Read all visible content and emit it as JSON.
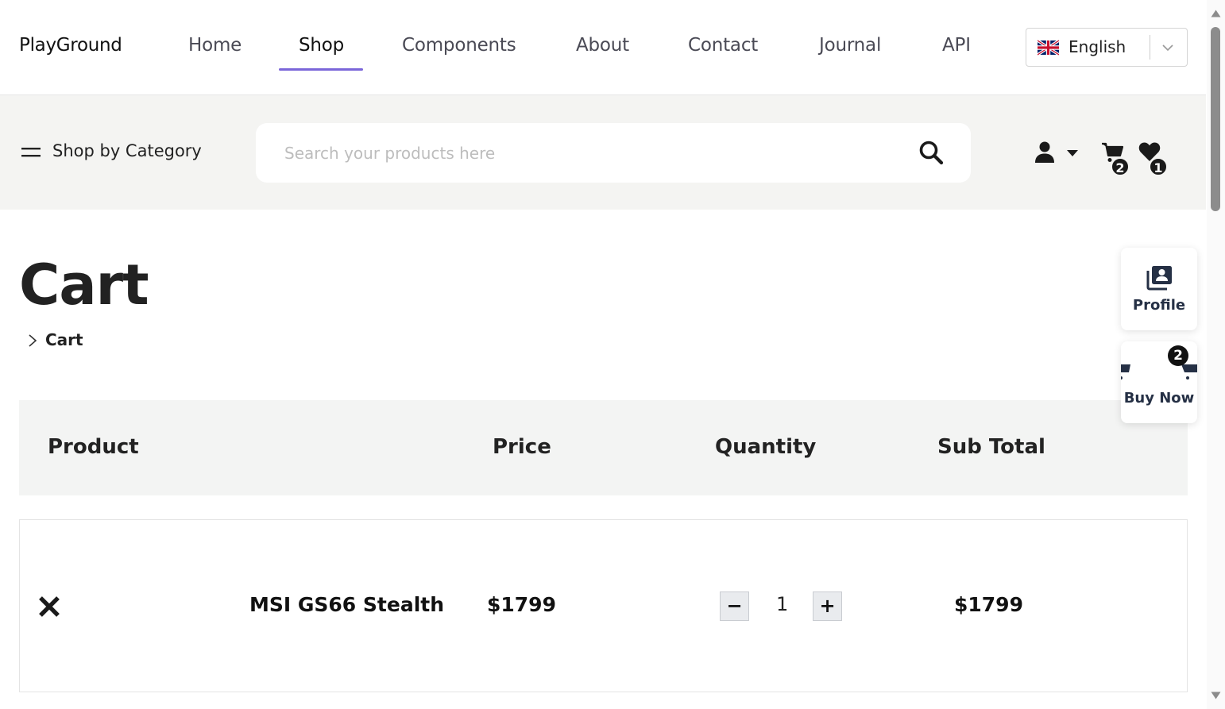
{
  "brand": "PlayGround",
  "nav": {
    "items": [
      {
        "label": "Home"
      },
      {
        "label": "Shop"
      },
      {
        "label": "Components"
      },
      {
        "label": "About"
      },
      {
        "label": "Contact"
      },
      {
        "label": "Journal"
      },
      {
        "label": "API"
      }
    ],
    "active": "Shop"
  },
  "language": {
    "selected": "English",
    "flag": "uk-flag-icon"
  },
  "category_menu": {
    "label": "Shop by Category",
    "icon": "hamburger-icon"
  },
  "search": {
    "placeholder": "Search your products here",
    "value": ""
  },
  "header_actions": {
    "cart_count": "2",
    "wishlist_count": "1"
  },
  "page": {
    "title": "Cart",
    "breadcrumb": "Cart"
  },
  "table": {
    "headers": {
      "product": "Product",
      "price": "Price",
      "quantity": "Quantity",
      "subtotal": "Sub Total"
    },
    "rows": [
      {
        "name": "MSI GS66 Stealth",
        "price": "$1799",
        "quantity": "1",
        "subtotal": "$1799",
        "decrement": "−",
        "increment": "+"
      }
    ]
  },
  "floating": {
    "profile_label": "Profile",
    "buy_label": "Buy Now",
    "buy_badge": "2"
  },
  "colors": {
    "accent": "#7b66d9",
    "band_bg": "#f4f4f2",
    "table_head_bg": "#f3f4f3",
    "text": "#222222",
    "float_label": "#253045"
  }
}
